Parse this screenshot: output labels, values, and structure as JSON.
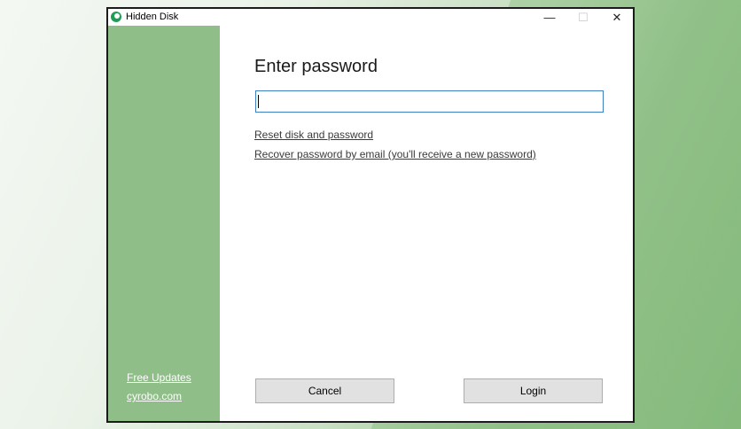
{
  "window": {
    "title": "Hidden Disk",
    "minimize_glyph": "—",
    "maximize_glyph": "☐",
    "close_glyph": "✕"
  },
  "sidebar": {
    "color": "#8fbe88",
    "links": [
      "Free Updates",
      "cyrobo.com"
    ]
  },
  "main": {
    "heading": "Enter password",
    "password_value": "",
    "reset_link": "Reset disk and password",
    "recover_link": "Recover password by email (you'll receive a new password)"
  },
  "buttons": {
    "cancel": "Cancel",
    "login": "Login"
  },
  "colors": {
    "accent": "#3c7fc3",
    "icon": "#1f9d55"
  }
}
